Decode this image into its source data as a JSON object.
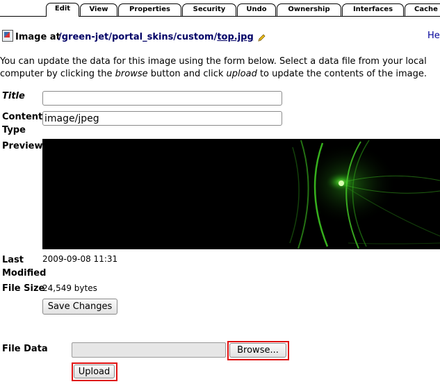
{
  "tabs": [
    {
      "label": "Edit",
      "active": true
    },
    {
      "label": "View"
    },
    {
      "label": "Properties"
    },
    {
      "label": "Security"
    },
    {
      "label": "Undo"
    },
    {
      "label": "Ownership"
    },
    {
      "label": "Interfaces"
    },
    {
      "label": "Cache"
    }
  ],
  "header": {
    "label": "Image at",
    "path_parts": [
      "/green-jet",
      "/portal_skins",
      "/custom",
      "/"
    ],
    "file_name": "top.jpg",
    "help": "He"
  },
  "description": {
    "part1": "You can update the data for this image using the form below. Select a data file from your local computer by clicking the ",
    "browse_word": "browse",
    "part2": " button and click ",
    "upload_word": "upload",
    "part3": " to update the contents of the image."
  },
  "form": {
    "title_label": "Title",
    "title_value": "",
    "content_type_label_1": "Content",
    "content_type_label_2": "Type",
    "content_type_value": "image/jpeg",
    "preview_label": "Preview",
    "last_modified_label_1": "Last",
    "last_modified_label_2": "Modified",
    "last_modified_value": "2009-09-08 11:31",
    "file_size_label": "File Size",
    "file_size_value": "24,549 bytes",
    "save_button": "Save Changes"
  },
  "upload": {
    "file_data_label": "File Data",
    "file_path_value": "",
    "browse_button": "Browse...",
    "upload_button": "Upload"
  },
  "colors": {
    "path_link": "#000066",
    "highlight_box": "#e01010",
    "preview_glow": "#4fe12a"
  }
}
